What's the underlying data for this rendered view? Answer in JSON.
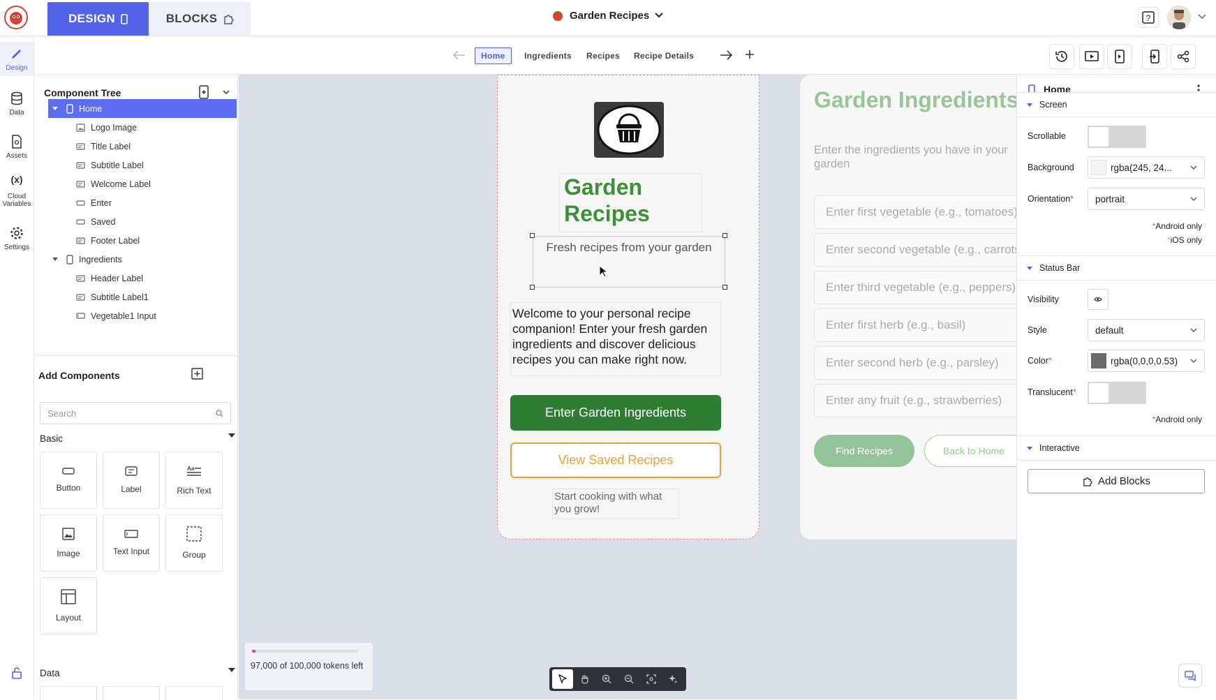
{
  "topbar": {
    "design_tab": "DESIGN",
    "blocks_tab": "BLOCKS",
    "project_name": "Garden Recipes"
  },
  "leftrail": {
    "items": [
      {
        "label": "Design"
      },
      {
        "label": "Data"
      },
      {
        "label": "Assets"
      },
      {
        "label": "Cloud Variables"
      },
      {
        "label": "Settings"
      }
    ],
    "cloud_icon_text": "(x)"
  },
  "pagebar": {
    "tabs": [
      "Home",
      "Ingredients",
      "Recipes",
      "Recipe Details"
    ]
  },
  "component_tree": {
    "title": "Component Tree",
    "rows": [
      {
        "label": "Home",
        "level": 0,
        "type": "screen",
        "selected": true
      },
      {
        "label": "Logo Image",
        "level": 1,
        "type": "image"
      },
      {
        "label": "Title Label",
        "level": 1,
        "type": "label"
      },
      {
        "label": "Subtitle Label",
        "level": 1,
        "type": "label"
      },
      {
        "label": "Welcome Label",
        "level": 1,
        "type": "label"
      },
      {
        "label": "Enter",
        "level": 1,
        "type": "button"
      },
      {
        "label": "Saved",
        "level": 1,
        "type": "button"
      },
      {
        "label": "Footer Label",
        "level": 1,
        "type": "label"
      },
      {
        "label": "Ingredients",
        "level": 0,
        "type": "screen"
      },
      {
        "label": "Header Label",
        "level": 1,
        "type": "label"
      },
      {
        "label": "Subtitle Label1",
        "level": 1,
        "type": "label"
      },
      {
        "label": "Vegetable1 Input",
        "level": 1,
        "type": "input"
      }
    ]
  },
  "add_components": {
    "title": "Add Components",
    "search_placeholder": "Search",
    "basic_section": "Basic",
    "data_section": "Data",
    "tiles": [
      "Button",
      "Label",
      "Rich Text",
      "Image",
      "Text Input",
      "Group",
      "Layout"
    ]
  },
  "home_screen": {
    "title": "Garden Recipes",
    "subtitle": "Fresh recipes from your garden",
    "welcome": "Welcome to your personal recipe companion! Enter your fresh garden ingredients and discover delicious recipes you can make right now.",
    "primary_button": "Enter Garden Ingredients",
    "secondary_button": "View Saved Recipes",
    "footer": "Start cooking with what you grow!"
  },
  "ingredients_screen": {
    "title": "Garden Ingredients",
    "subtitle": "Enter the ingredients you have in your garden",
    "inputs": [
      "Enter first vegetable (e.g., tomatoes)",
      "Enter second vegetable (e.g., carrots)",
      "Enter third vegetable (e.g., peppers)",
      "Enter first herb (e.g., basil)",
      "Enter second herb (e.g., parsley)",
      "Enter any fruit (e.g., strawberries)"
    ],
    "find_button": "Find Recipes",
    "back_button": "Back to Home"
  },
  "properties": {
    "title": "Home",
    "screen_section": "Screen",
    "scrollable_label": "Scrollable",
    "background_label": "Background",
    "background_value": "rgba(245, 24...",
    "orientation_label": "Orientation",
    "orientation_value": "portrait",
    "android_only": "Android only",
    "ios_only": "iOS only",
    "status_bar_section": "Status Bar",
    "visibility_label": "Visibility",
    "style_label": "Style",
    "style_value": "default",
    "color_label": "Color",
    "color_value": "rgba(0,0,0,0.53)",
    "translucent_label": "Translucent",
    "android_only_2": "Android only",
    "interactive_section": "Interactive",
    "add_blocks": "Add Blocks"
  },
  "tokens": {
    "text": "97,000 of 100,000 tokens left",
    "used_fraction": 0.03
  },
  "colors": {
    "accent": "#5263e8",
    "primary_green": "#2e7d32",
    "title_green": "#3f8f3a",
    "orange": "#f0a030"
  }
}
